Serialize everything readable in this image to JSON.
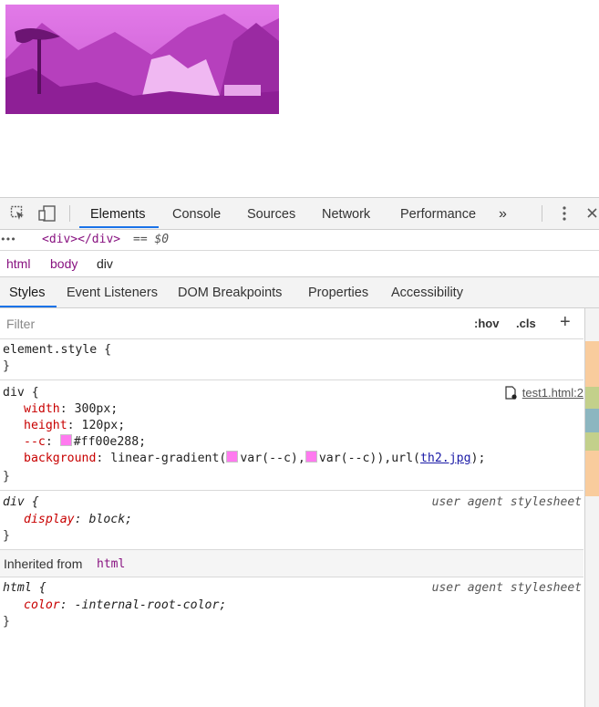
{
  "toolbar": {
    "tabs": [
      "Elements",
      "Console",
      "Sources",
      "Network",
      "Performance"
    ],
    "more": "»"
  },
  "crumb": {
    "ellipsis": "•••",
    "node": "<div></div>",
    "eq": "== $0"
  },
  "path": [
    "html",
    "body",
    "div"
  ],
  "subtabs": [
    "Styles",
    "Event Listeners",
    "DOM Breakpoints",
    "Properties",
    "Accessibility"
  ],
  "filter": {
    "placeholder": "Filter",
    "hov": ":hov",
    "cls": ".cls",
    "add": "+"
  },
  "rules": {
    "element_style": "element.style {",
    "close": "}",
    "div_selector": "div {",
    "source": "test1.html:2",
    "width_prop": "width",
    "width_val": "300px;",
    "height_prop": "height",
    "height_val": "120px;",
    "c_prop": "--c",
    "c_val": "#ff00e288;",
    "bg_prop": "background",
    "bg_val_1": "linear-gradient(",
    "bg_var_1": "var(--c),",
    "bg_var_2": "var(--c)),url(",
    "bg_url": "th2.jpg",
    "bg_end": ");",
    "ua_selector": "div {",
    "ua_source": "user agent stylesheet",
    "display_prop": "display",
    "display_val": "block;",
    "inherited_label": "Inherited from",
    "inherited_tag": "html",
    "html_selector": "html {",
    "html_source": "user agent stylesheet",
    "color_prop": "color",
    "color_val": "-internal-root-color;"
  },
  "colors": {
    "accent": "#1a73e8",
    "css_prop": "#c80000",
    "overlay": "#ff00e2"
  }
}
